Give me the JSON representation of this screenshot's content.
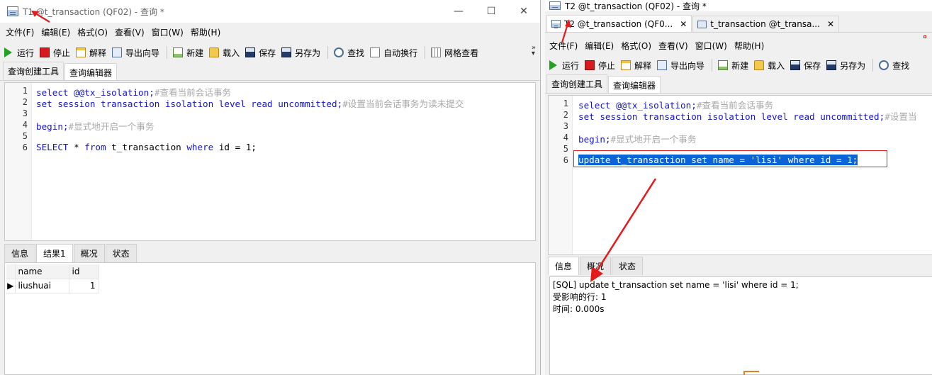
{
  "window1": {
    "title": "T1 @t_transaction (QF02) - 查询 *",
    "controls": [
      "—",
      "☐",
      "✕"
    ],
    "menu": [
      "文件(F)",
      "编辑(E)",
      "格式(O)",
      "查看(V)",
      "窗口(W)",
      "帮助(H)"
    ],
    "toolbar": [
      "运行",
      "停止",
      "解释",
      "导出向导",
      "新建",
      "载入",
      "保存",
      "另存为",
      "查找",
      "自动换行",
      "网格查看"
    ],
    "tabs": [
      "查询创建工具",
      "查询编辑器"
    ],
    "active_tab": "查询编辑器",
    "line_numbers": [
      "1",
      "2",
      "3",
      "4",
      "5",
      "6"
    ],
    "code": {
      "l1": "select @@tx_isolation;",
      "l1_comment": "#查看当前会话事务",
      "l2": "set session transaction isolation level read uncommitted;",
      "l2_comment": "#设置当前会话事务为读未提交",
      "l4": "begin;",
      "l4_comment": "#显式地开启一个事务",
      "l6_a": "SELECT",
      "l6_b": " * ",
      "l6_c": "from",
      "l6_d": " t_transaction ",
      "l6_e": "where",
      "l6_f": " id = 1;"
    },
    "result_tabs": [
      "信息",
      "结果1",
      "概况",
      "状态"
    ],
    "active_result_tab": "结果1",
    "result": {
      "columns": [
        "name",
        "id"
      ],
      "rows": [
        [
          "liushuai",
          "1"
        ]
      ]
    }
  },
  "window2": {
    "title": "T2 @t_transaction (QF02) - 查询 *",
    "doc_tabs": [
      "T2 @t_transaction (QF0...",
      "t_transaction @t_transa..."
    ],
    "doc_tab_close": "✕",
    "menu": [
      "文件(F)",
      "编辑(E)",
      "格式(O)",
      "查看(V)",
      "窗口(W)",
      "帮助(H)"
    ],
    "toolbar": [
      "运行",
      "停止",
      "解释",
      "导出向导",
      "新建",
      "载入",
      "保存",
      "另存为",
      "查找"
    ],
    "tabs": [
      "查询创建工具",
      "查询编辑器"
    ],
    "active_tab": "查询编辑器",
    "line_numbers": [
      "1",
      "2",
      "3",
      "4",
      "5",
      "6"
    ],
    "code": {
      "l1": "select @@tx_isolation;",
      "l1_comment": "#查看当前会话事务",
      "l2": "set session transaction isolation level read uncommitted;",
      "l2_comment": "#设置当",
      "l4": "begin;",
      "l4_comment": "#显式地开启一个事务",
      "l6": "update t_transaction set name = 'lisi' where id = 1;"
    },
    "result_tabs": [
      "信息",
      "概况",
      "状态"
    ],
    "active_result_tab": "信息",
    "info": {
      "line1": "[SQL] update t_transaction set name = 'lisi' where id = 1;",
      "line2": "受影响的行: 1",
      "line3": "时间: 0.000s"
    }
  },
  "colors": {
    "annotation_red": "#e21b1b",
    "selection_blue": "#0a64d8",
    "keyword_blue": "#1515c8",
    "comment_gray": "#a8a8a8"
  }
}
